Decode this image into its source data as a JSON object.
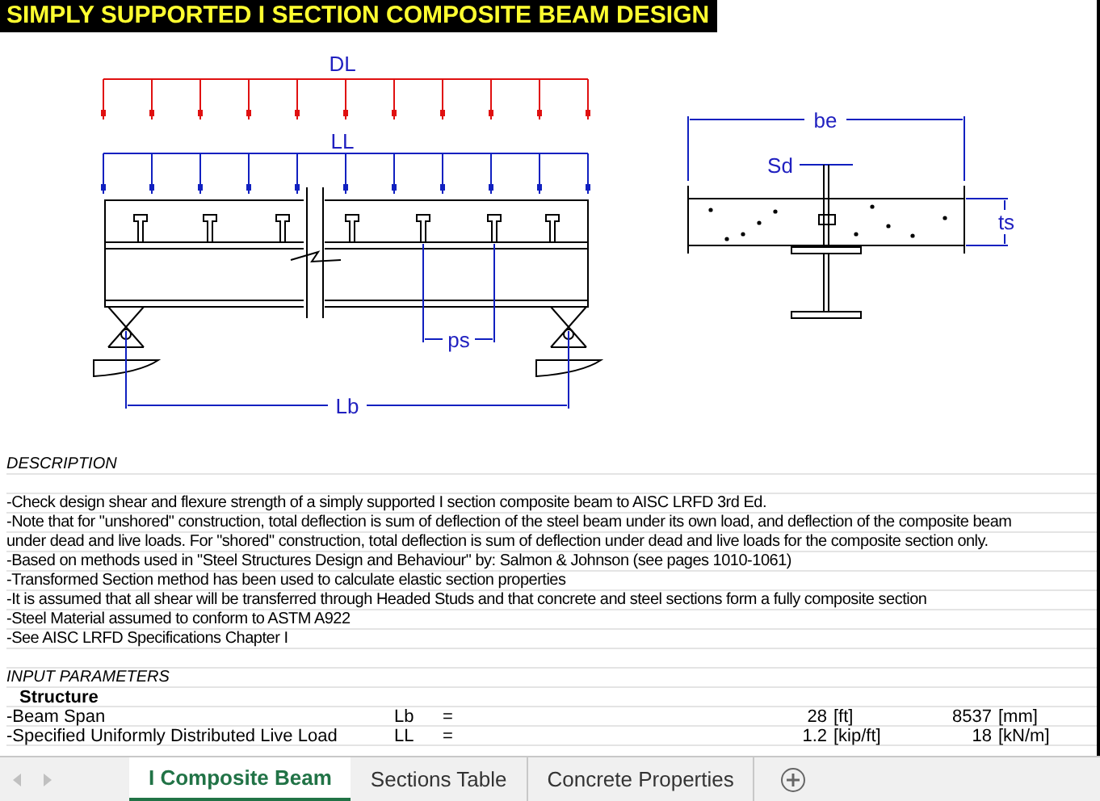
{
  "title": "SIMPLY SUPPORTED I SECTION COMPOSITE BEAM DESIGN",
  "beam_drawing": {
    "dead_load": "DL",
    "live_load": "LL",
    "stud_pitch": "ps",
    "span": "Lb"
  },
  "section_drawing": {
    "effective_width": "be",
    "stud_diameter": "Sd",
    "slab_thickness": "ts"
  },
  "description": {
    "heading": "DESCRIPTION",
    "lines": [
      "-Check design shear and flexure strength of a simply supported I section composite beam to AISC LRFD 3rd Ed.",
      "-Note that for \"unshored\" construction, total deflection is sum of deflection of the steel beam under its own load, and deflection of the composite beam",
      "under dead and live loads.  For \"shored\" construction, total deflection is sum of deflection under dead and live loads for the composite section only.",
      "-Based on methods used in \"Steel Structures Design and Behaviour\" by: Salmon & Johnson (see pages 1010-1061)",
      "-Transformed Section method has been used to calculate elastic section properties",
      "-It is assumed that all shear will be transferred through Headed Studs and that concrete and steel sections form a fully composite section",
      "-Steel Material assumed to conform to ASTM A922",
      "-See AISC LRFD Specifications Chapter I"
    ]
  },
  "input_parameters": {
    "heading": "INPUT PARAMETERS",
    "group": "Structure",
    "rows": [
      {
        "label": "-Beam Span",
        "symbol": "Lb",
        "equals": "=",
        "value": "28",
        "unit": "[ft]",
        "value_si": "8537",
        "unit_si": "[mm]"
      },
      {
        "label": "-Specified Uniformly Distributed Live Load",
        "symbol": "LL",
        "equals": "=",
        "value": "1.2",
        "unit": "[kip/ft]",
        "value_si": "18",
        "unit_si": "[kN/m]"
      }
    ]
  },
  "sheet_tabs": [
    {
      "label": "I Composite Beam",
      "selected": true
    },
    {
      "label": "Sections Table",
      "selected": false
    },
    {
      "label": "Concrete Properties",
      "selected": false
    }
  ]
}
